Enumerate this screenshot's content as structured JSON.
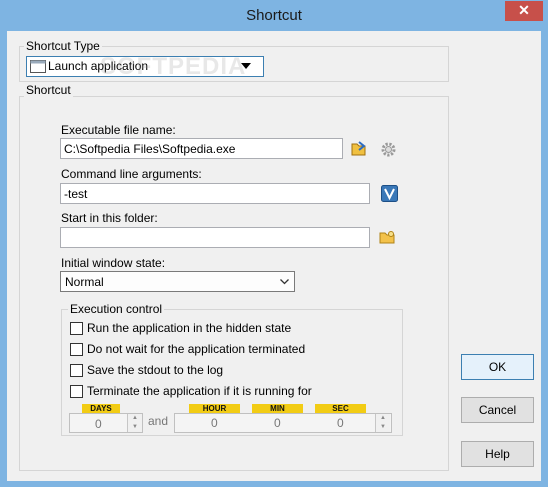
{
  "window": {
    "title": "Shortcut",
    "close_glyph": "✕"
  },
  "shortcut_type": {
    "group_label": "Shortcut Type",
    "selected": "Launch application"
  },
  "shortcut": {
    "group_label": "Shortcut",
    "exe_label": "Executable file name:",
    "exe_value": "C:\\Softpedia Files\\Softpedia.exe",
    "args_label": "Command line arguments:",
    "args_value": "-test",
    "folder_label": "Start in this folder:",
    "folder_value": "",
    "window_state_label": "Initial window state:",
    "window_state_value": "Normal"
  },
  "execution": {
    "group_label": "Execution control",
    "options": [
      {
        "label": "Run the application in the hidden state",
        "checked": false
      },
      {
        "label": "Do not wait for the application terminated",
        "checked": false
      },
      {
        "label": "Save the stdout to the log",
        "checked": false
      },
      {
        "label": "Terminate the application if it is running for",
        "checked": false
      }
    ],
    "days_label": "DAYS",
    "hour_label": "HOUR",
    "min_label": "MIN",
    "sec_label": "SEC",
    "and_label": "and",
    "days_value": "0",
    "hour_value": "0",
    "min_value": "0",
    "sec_value": "0"
  },
  "buttons": {
    "ok": "OK",
    "cancel": "Cancel",
    "help": "Help"
  },
  "watermark": "SOFTPEDIA",
  "icons": [
    "browse-file-icon",
    "settings-gear-icon",
    "variables-icon",
    "browse-folder-icon",
    "application-icon",
    "dropdown-arrow-icon",
    "checkbox-icon",
    "spin-arrows-icon",
    "close-icon"
  ]
}
